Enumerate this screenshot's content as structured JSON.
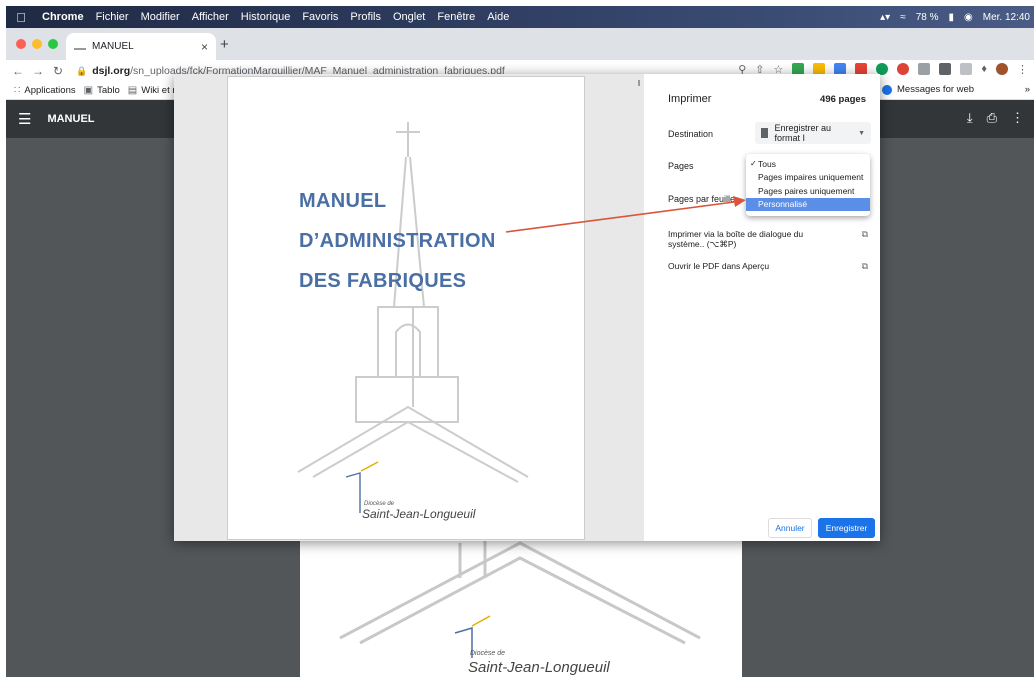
{
  "menubar": {
    "app": "Chrome",
    "items": [
      "Fichier",
      "Modifier",
      "Afficher",
      "Historique",
      "Favoris",
      "Profils",
      "Onglet",
      "Fenêtre",
      "Aide"
    ],
    "battery": "78 %",
    "clock": "Mer. 12:40"
  },
  "tab": {
    "title": "MANUEL",
    "close": "×",
    "new": "+"
  },
  "toolbar": {
    "url_host": "dsjl.org",
    "url_path": "/sn_uploads/fck/FormationMarguillier/MAF_Manuel_administration_fabriques.pdf"
  },
  "bookmarks": {
    "apps": "Applications",
    "items": [
      "Tablo",
      "Wiki et réf"
    ],
    "right_item": "Messages for web",
    "overflow": "»"
  },
  "pdf": {
    "title": "MANUEL"
  },
  "document": {
    "title_lines": [
      "MANUEL",
      "D’ADMINISTRATION",
      "DES FABRIQUES"
    ],
    "logo_small": "Diocèse de",
    "logo_name": "Saint-Jean-Longueuil"
  },
  "print": {
    "heading": "Imprimer",
    "page_count": "496 pages",
    "destination_label": "Destination",
    "destination_value": "Enregistrer au format I",
    "pages_label": "Pages",
    "pages_per_sheet_label": "Pages par feuille",
    "system_dialog": "Imprimer via la boîte de dialogue du système.. (⌥⌘P)",
    "open_preview": "Ouvrir le PDF dans Aperçu",
    "cancel": "Annuler",
    "save": "Enregistrer"
  },
  "pages_dropdown": {
    "options": [
      "Tous",
      "Pages impaires uniquement",
      "Pages paires uniquement",
      "Personnalisé"
    ],
    "checked_index": 0,
    "highlighted_index": 3
  },
  "colors": {
    "accent": "#1a73e8",
    "title_blue": "#4a6fa5",
    "arrow_red": "#d9543a",
    "highlight": "#5b8ee6"
  }
}
